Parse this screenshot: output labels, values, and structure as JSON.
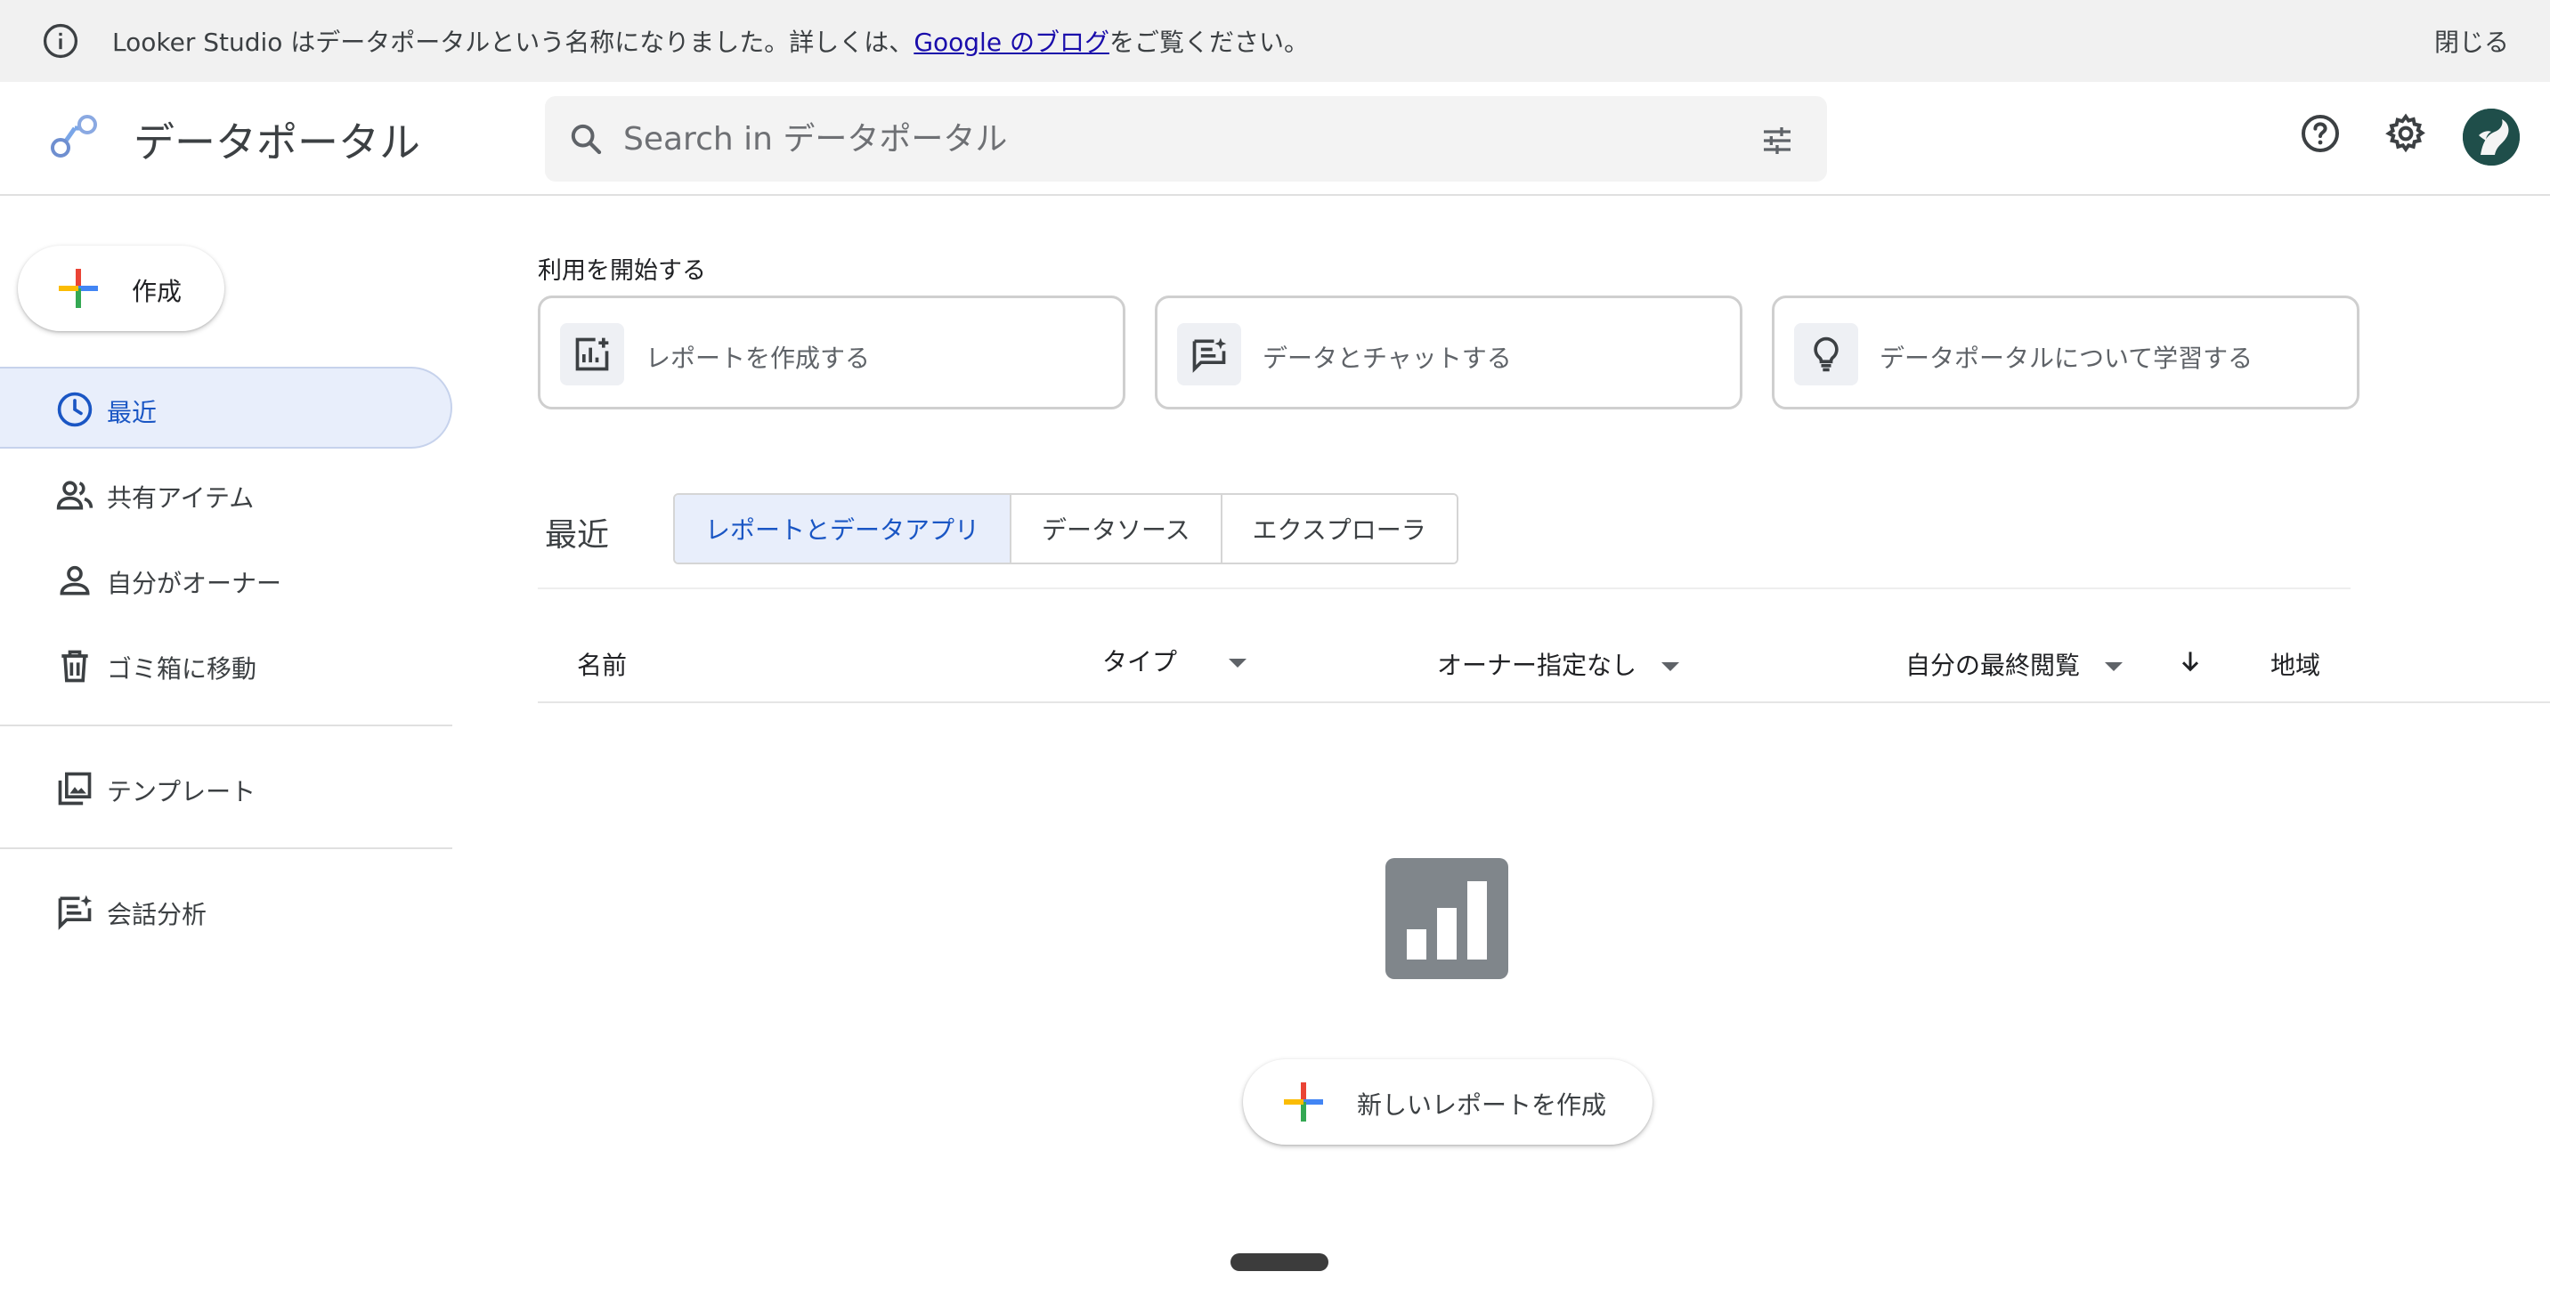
{
  "banner": {
    "prefix": "Looker Studio はデータポータルという名称になりました。詳しくは、",
    "link": "Google のブログ",
    "suffix": "をご覧ください。",
    "close_label": "閉じる"
  },
  "header": {
    "app_title": "データポータル",
    "search_placeholder": "Search in データポータル"
  },
  "sidebar": {
    "create_label": "作成",
    "items": [
      {
        "label": "最近",
        "icon": "clock-icon",
        "active": true
      },
      {
        "label": "共有アイテム",
        "icon": "people-icon"
      },
      {
        "label": "自分がオーナー",
        "icon": "person-icon"
      },
      {
        "label": "ゴミ箱に移動",
        "icon": "trash-icon"
      },
      {
        "label": "テンプレート",
        "icon": "template-icon"
      },
      {
        "label": "会話分析",
        "icon": "conversation-icon"
      }
    ]
  },
  "main": {
    "start_title": "利用を開始する",
    "start_cards": [
      {
        "label": "レポートを作成する",
        "icon": "add-chart-icon"
      },
      {
        "label": "データとチャットする",
        "icon": "chat-spark-icon"
      },
      {
        "label": "データポータルについて学習する",
        "icon": "lightbulb-icon"
      }
    ],
    "recent_title": "最近",
    "tabs": [
      "レポートとデータアプリ",
      "データソース",
      "エクスプローラ"
    ],
    "columns": {
      "name": "名前",
      "type": "タイプ",
      "owner": "オーナー指定なし",
      "last_viewed": "自分の最終閲覧",
      "region": "地域"
    },
    "new_report_label": "新しいレポートを作成"
  },
  "colors": {
    "accent": "#1a56c4",
    "active_bg": "#e8eefb",
    "banner_bg": "#f1f1f1",
    "plus_red": "#ea4335",
    "plus_blue": "#4285f4",
    "plus_green": "#34a853",
    "plus_yellow": "#fbbc04"
  }
}
